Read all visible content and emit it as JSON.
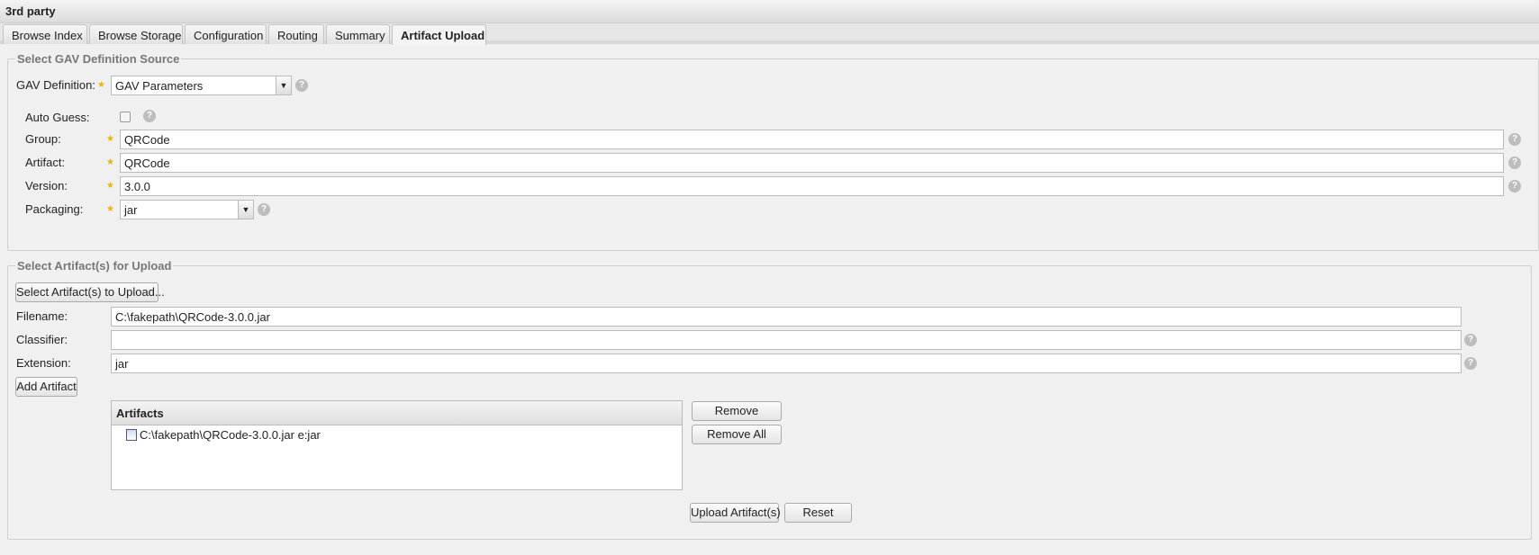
{
  "window": {
    "title": "3rd party"
  },
  "tabs": [
    {
      "label": "Browse Index"
    },
    {
      "label": "Browse Storage"
    },
    {
      "label": "Configuration"
    },
    {
      "label": "Routing"
    },
    {
      "label": "Summary"
    },
    {
      "label": "Artifact Upload",
      "active": true
    }
  ],
  "gav": {
    "legend": "Select GAV Definition Source",
    "definition_label": "GAV Definition:",
    "definition_value": "GAV Parameters",
    "auto_guess_label": "Auto Guess:",
    "auto_guess_checked": false,
    "group_label": "Group:",
    "group_value": "QRCode",
    "artifact_label": "Artifact:",
    "artifact_value": "QRCode",
    "version_label": "Version:",
    "version_value": "3.0.0",
    "packaging_label": "Packaging:",
    "packaging_value": "jar"
  },
  "upload": {
    "legend": "Select Artifact(s) for Upload",
    "select_button": "Select Artifact(s) to Upload...",
    "filename_label": "Filename:",
    "filename_value": "C:\\fakepath\\QRCode-3.0.0.jar",
    "classifier_label": "Classifier:",
    "classifier_value": "",
    "extension_label": "Extension:",
    "extension_value": "jar",
    "add_button": "Add Artifact",
    "grid": {
      "header": "Artifacts",
      "rows": [
        {
          "label": "C:\\fakepath\\QRCode-3.0.0.jar e:jar"
        }
      ]
    },
    "remove_button": "Remove",
    "remove_all_button": "Remove All",
    "upload_button": "Upload Artifact(s)",
    "reset_button": "Reset"
  },
  "icons": {
    "help": "?",
    "arrow": "▼"
  }
}
